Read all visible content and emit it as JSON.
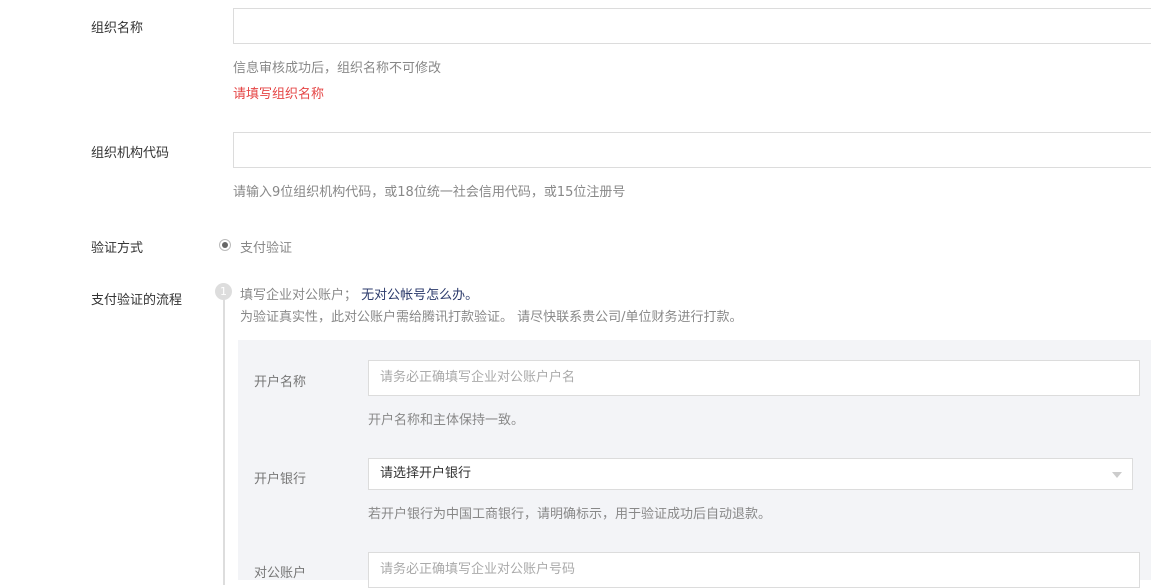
{
  "org_name": {
    "label": "组织名称",
    "hint": "信息审核成功后，组织名称不可修改",
    "error": "请填写组织名称"
  },
  "org_code": {
    "label": "组织机构代码",
    "hint": "请输入9位组织机构代码，或18位统一社会信用代码，或15位注册号"
  },
  "verify_method": {
    "label": "验证方式",
    "option": "支付验证"
  },
  "flow": {
    "label": "支付验证的流程",
    "step_number": "1",
    "step_text": "填写企业对公账户；",
    "link": "无对公帐号怎么办。",
    "desc": "为验证真实性，此对公账户需给腾讯打款验证。 请尽快联系贵公司/单位财务进行打款。"
  },
  "account_name": {
    "label": "开户名称",
    "placeholder": "请务必正确填写企业对公账户户名",
    "hint": "开户名称和主体保持一致。"
  },
  "bank": {
    "label": "开户银行",
    "value": "请选择开户银行",
    "hint": "若开户银行为中国工商银行，请明确标示，用于验证成功后自动退款。"
  },
  "account_no": {
    "label": "对公账户",
    "placeholder": "请务必正确填写企业对公账户号码"
  }
}
